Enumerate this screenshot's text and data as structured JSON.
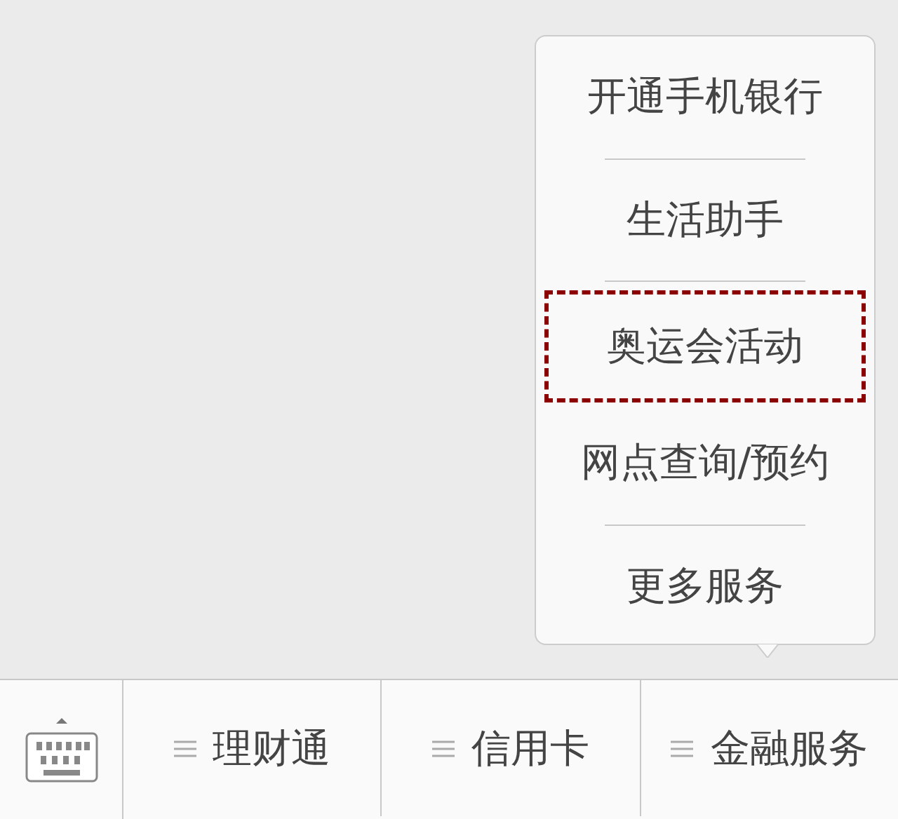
{
  "popup_menu": {
    "items": [
      {
        "label": "开通手机银行",
        "highlighted": false
      },
      {
        "label": "生活助手",
        "highlighted": false
      },
      {
        "label": "奥运会活动",
        "highlighted": true
      },
      {
        "label": "网点查询/预约",
        "highlighted": false
      },
      {
        "label": "更多服务",
        "highlighted": false
      }
    ]
  },
  "bottom_bar": {
    "tabs": [
      {
        "label": "理财通"
      },
      {
        "label": "信用卡"
      },
      {
        "label": "金融服务"
      }
    ]
  }
}
